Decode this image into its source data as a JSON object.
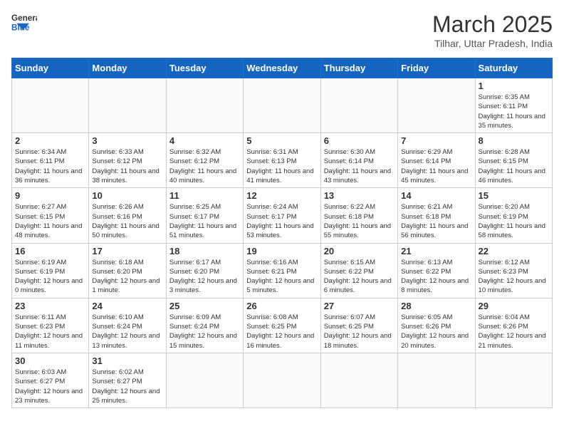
{
  "logo": {
    "text_general": "General",
    "text_blue": "Blue"
  },
  "title": "March 2025",
  "subtitle": "Tilhar, Uttar Pradesh, India",
  "weekdays": [
    "Sunday",
    "Monday",
    "Tuesday",
    "Wednesday",
    "Thursday",
    "Friday",
    "Saturday"
  ],
  "days": [
    {
      "date": "",
      "info": ""
    },
    {
      "date": "",
      "info": ""
    },
    {
      "date": "",
      "info": ""
    },
    {
      "date": "",
      "info": ""
    },
    {
      "date": "",
      "info": ""
    },
    {
      "date": "",
      "info": ""
    },
    {
      "date": "1",
      "info": "Sunrise: 6:35 AM\nSunset: 6:11 PM\nDaylight: 11 hours\nand 35 minutes."
    },
    {
      "date": "2",
      "info": "Sunrise: 6:34 AM\nSunset: 6:11 PM\nDaylight: 11 hours\nand 36 minutes."
    },
    {
      "date": "3",
      "info": "Sunrise: 6:33 AM\nSunset: 6:12 PM\nDaylight: 11 hours\nand 38 minutes."
    },
    {
      "date": "4",
      "info": "Sunrise: 6:32 AM\nSunset: 6:12 PM\nDaylight: 11 hours\nand 40 minutes."
    },
    {
      "date": "5",
      "info": "Sunrise: 6:31 AM\nSunset: 6:13 PM\nDaylight: 11 hours\nand 41 minutes."
    },
    {
      "date": "6",
      "info": "Sunrise: 6:30 AM\nSunset: 6:14 PM\nDaylight: 11 hours\nand 43 minutes."
    },
    {
      "date": "7",
      "info": "Sunrise: 6:29 AM\nSunset: 6:14 PM\nDaylight: 11 hours\nand 45 minutes."
    },
    {
      "date": "8",
      "info": "Sunrise: 6:28 AM\nSunset: 6:15 PM\nDaylight: 11 hours\nand 46 minutes."
    },
    {
      "date": "9",
      "info": "Sunrise: 6:27 AM\nSunset: 6:15 PM\nDaylight: 11 hours\nand 48 minutes."
    },
    {
      "date": "10",
      "info": "Sunrise: 6:26 AM\nSunset: 6:16 PM\nDaylight: 11 hours\nand 50 minutes."
    },
    {
      "date": "11",
      "info": "Sunrise: 6:25 AM\nSunset: 6:17 PM\nDaylight: 11 hours\nand 51 minutes."
    },
    {
      "date": "12",
      "info": "Sunrise: 6:24 AM\nSunset: 6:17 PM\nDaylight: 11 hours\nand 53 minutes."
    },
    {
      "date": "13",
      "info": "Sunrise: 6:22 AM\nSunset: 6:18 PM\nDaylight: 11 hours\nand 55 minutes."
    },
    {
      "date": "14",
      "info": "Sunrise: 6:21 AM\nSunset: 6:18 PM\nDaylight: 11 hours\nand 56 minutes."
    },
    {
      "date": "15",
      "info": "Sunrise: 6:20 AM\nSunset: 6:19 PM\nDaylight: 11 hours\nand 58 minutes."
    },
    {
      "date": "16",
      "info": "Sunrise: 6:19 AM\nSunset: 6:19 PM\nDaylight: 12 hours\nand 0 minutes."
    },
    {
      "date": "17",
      "info": "Sunrise: 6:18 AM\nSunset: 6:20 PM\nDaylight: 12 hours\nand 1 minute."
    },
    {
      "date": "18",
      "info": "Sunrise: 6:17 AM\nSunset: 6:20 PM\nDaylight: 12 hours\nand 3 minutes."
    },
    {
      "date": "19",
      "info": "Sunrise: 6:16 AM\nSunset: 6:21 PM\nDaylight: 12 hours\nand 5 minutes."
    },
    {
      "date": "20",
      "info": "Sunrise: 6:15 AM\nSunset: 6:22 PM\nDaylight: 12 hours\nand 6 minutes."
    },
    {
      "date": "21",
      "info": "Sunrise: 6:13 AM\nSunset: 6:22 PM\nDaylight: 12 hours\nand 8 minutes."
    },
    {
      "date": "22",
      "info": "Sunrise: 6:12 AM\nSunset: 6:23 PM\nDaylight: 12 hours\nand 10 minutes."
    },
    {
      "date": "23",
      "info": "Sunrise: 6:11 AM\nSunset: 6:23 PM\nDaylight: 12 hours\nand 11 minutes."
    },
    {
      "date": "24",
      "info": "Sunrise: 6:10 AM\nSunset: 6:24 PM\nDaylight: 12 hours\nand 13 minutes."
    },
    {
      "date": "25",
      "info": "Sunrise: 6:09 AM\nSunset: 6:24 PM\nDaylight: 12 hours\nand 15 minutes."
    },
    {
      "date": "26",
      "info": "Sunrise: 6:08 AM\nSunset: 6:25 PM\nDaylight: 12 hours\nand 16 minutes."
    },
    {
      "date": "27",
      "info": "Sunrise: 6:07 AM\nSunset: 6:25 PM\nDaylight: 12 hours\nand 18 minutes."
    },
    {
      "date": "28",
      "info": "Sunrise: 6:05 AM\nSunset: 6:26 PM\nDaylight: 12 hours\nand 20 minutes."
    },
    {
      "date": "29",
      "info": "Sunrise: 6:04 AM\nSunset: 6:26 PM\nDaylight: 12 hours\nand 21 minutes."
    },
    {
      "date": "30",
      "info": "Sunrise: 6:03 AM\nSunset: 6:27 PM\nDaylight: 12 hours\nand 23 minutes."
    },
    {
      "date": "31",
      "info": "Sunrise: 6:02 AM\nSunset: 6:27 PM\nDaylight: 12 hours\nand 25 minutes."
    },
    {
      "date": "",
      "info": ""
    },
    {
      "date": "",
      "info": ""
    },
    {
      "date": "",
      "info": ""
    },
    {
      "date": "",
      "info": ""
    },
    {
      "date": "",
      "info": ""
    }
  ]
}
